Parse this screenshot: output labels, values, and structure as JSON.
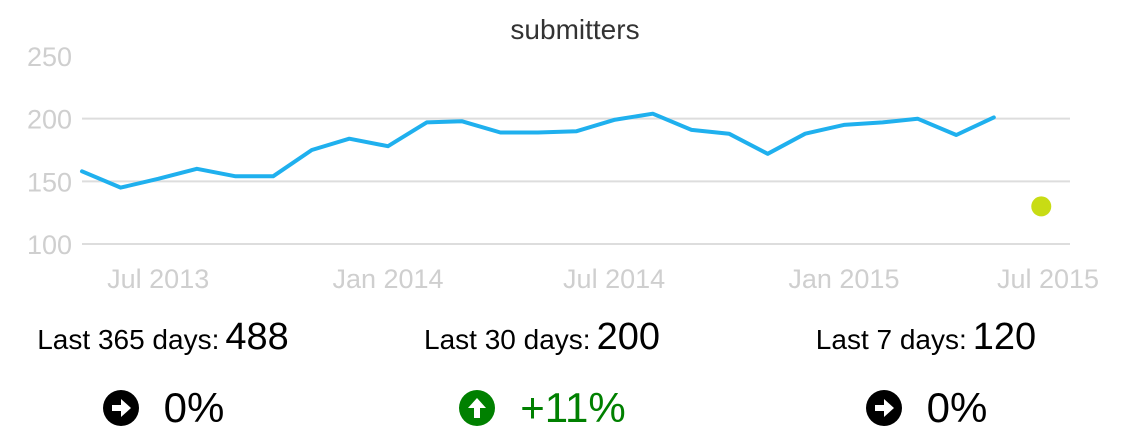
{
  "chart_data": {
    "type": "line",
    "title": "submitters",
    "xlabel": "",
    "ylabel": "",
    "ylim": [
      100,
      250
    ],
    "yticks": [
      100,
      150,
      200,
      250
    ],
    "xticks": [
      {
        "label": "Jul 2013",
        "value": "2013-07-01"
      },
      {
        "label": "Jan 2014",
        "value": "2014-01-01"
      },
      {
        "label": "Jul 2014",
        "value": "2014-07-01"
      },
      {
        "label": "Jan 2015",
        "value": "2015-01-01"
      },
      {
        "label": "Jul 2015",
        "value": "2015-07-01"
      }
    ],
    "xlim": [
      "2013-05-01",
      "2015-07-01"
    ],
    "grid": true,
    "series": [
      {
        "color": "#1fb0ee",
        "points": [
          {
            "x": "2013-05-01",
            "y": 158
          },
          {
            "x": "2013-06-01",
            "y": 145
          },
          {
            "x": "2013-07-01",
            "y": 152
          },
          {
            "x": "2013-08-01",
            "y": 160
          },
          {
            "x": "2013-09-01",
            "y": 154
          },
          {
            "x": "2013-10-01",
            "y": 154
          },
          {
            "x": "2013-11-01",
            "y": 175
          },
          {
            "x": "2013-12-01",
            "y": 184
          },
          {
            "x": "2014-01-01",
            "y": 178
          },
          {
            "x": "2014-02-01",
            "y": 197
          },
          {
            "x": "2014-03-01",
            "y": 198
          },
          {
            "x": "2014-04-01",
            "y": 189
          },
          {
            "x": "2014-05-01",
            "y": 189
          },
          {
            "x": "2014-06-01",
            "y": 190
          },
          {
            "x": "2014-07-01",
            "y": 199
          },
          {
            "x": "2014-08-01",
            "y": 204
          },
          {
            "x": "2014-09-01",
            "y": 191
          },
          {
            "x": "2014-10-01",
            "y": 188
          },
          {
            "x": "2014-11-01",
            "y": 172
          },
          {
            "x": "2014-12-01",
            "y": 188
          },
          {
            "x": "2015-01-01",
            "y": 195
          },
          {
            "x": "2015-02-01",
            "y": 197
          },
          {
            "x": "2015-03-01",
            "y": 200
          },
          {
            "x": "2015-04-01",
            "y": 187
          },
          {
            "x": "2015-05-01",
            "y": 201
          }
        ]
      },
      {
        "color": "#c8dc14",
        "type": "scatter",
        "points": [
          {
            "x": "2015-06-08",
            "y": 130
          }
        ]
      }
    ]
  },
  "stats": [
    {
      "label": "Last 365 days:",
      "value": "488",
      "change": "0%",
      "direction": "neutral",
      "color": "#000000"
    },
    {
      "label": "Last 30 days:",
      "value": "200",
      "change": "+11%",
      "direction": "up",
      "color": "#008000"
    },
    {
      "label": "Last 7 days:",
      "value": "120",
      "change": "0%",
      "direction": "neutral",
      "color": "#000000"
    }
  ],
  "icons": {
    "neutral": "arrow-right-circle-icon",
    "up": "arrow-up-circle-icon"
  }
}
